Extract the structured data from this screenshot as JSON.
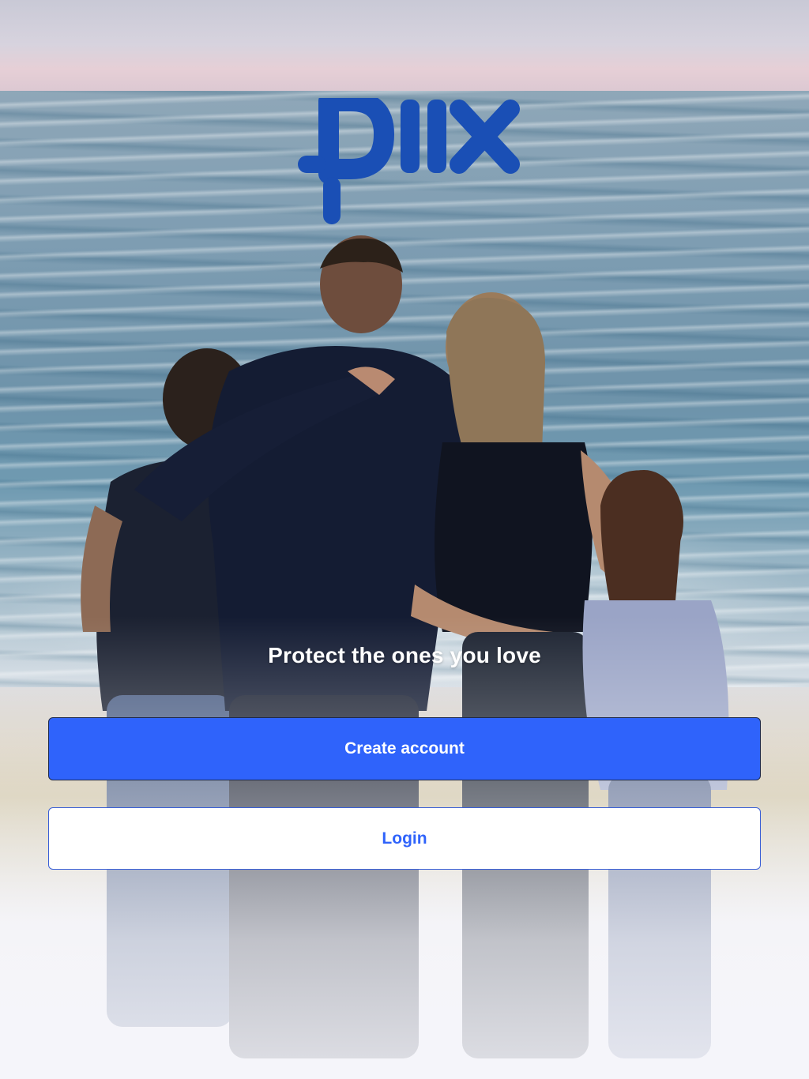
{
  "brand": {
    "logo_text": "piix",
    "logo_color": "#1a4fb5"
  },
  "tagline": "Protect the ones you love",
  "actions": {
    "create_account_label": "Create account",
    "login_label": "Login"
  },
  "colors": {
    "primary": "#2f63fb",
    "on_primary": "#ffffff"
  }
}
